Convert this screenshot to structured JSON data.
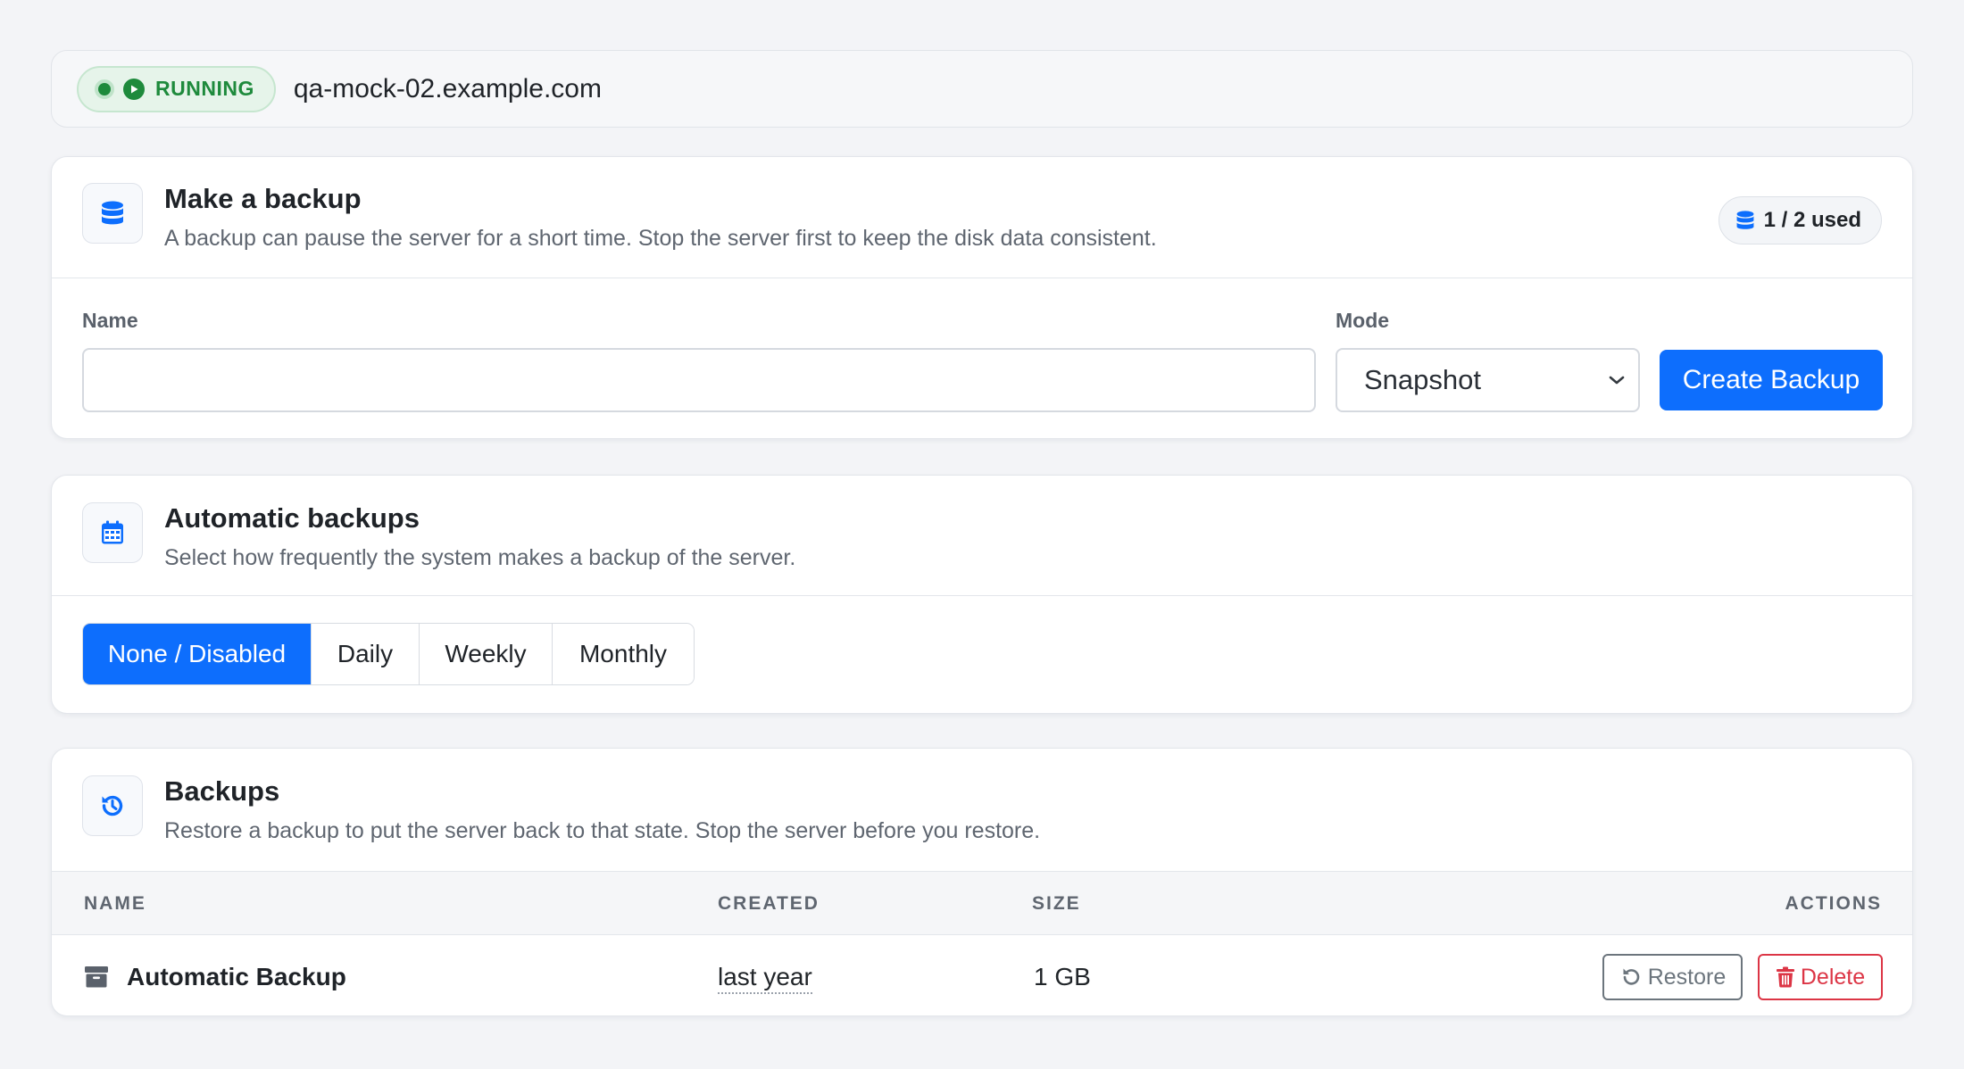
{
  "status": {
    "state_label": "RUNNING",
    "hostname": "qa-mock-02.example.com",
    "state_color": "#1e8a3c"
  },
  "make_backup": {
    "icon": "database-icon",
    "title": "Make a backup",
    "subtitle": "A backup can pause the server for a short time. Stop the server first to keep the disk data consistent.",
    "usage": "1 / 2 used",
    "name_label": "Name",
    "name_value": "",
    "name_placeholder": "",
    "mode_label": "Mode",
    "mode_value": "Snapshot",
    "create_label": "Create Backup"
  },
  "automatic": {
    "icon": "calendar-icon",
    "title": "Automatic backups",
    "subtitle": "Select how frequently the system makes a backup of the server.",
    "options": [
      "None / Disabled",
      "Daily",
      "Weekly",
      "Monthly"
    ],
    "selected": "None / Disabled"
  },
  "backups": {
    "icon": "history-icon",
    "title": "Backups",
    "subtitle": "Restore a backup to put the server back to that state. Stop the server before you restore.",
    "columns": {
      "name": "NAME",
      "created": "CREATED",
      "size": "SIZE",
      "actions": "ACTIONS"
    },
    "rows": [
      {
        "name": "Automatic Backup",
        "created": "last year",
        "size": "1 GB",
        "restore_label": "Restore",
        "delete_label": "Delete"
      }
    ]
  },
  "colors": {
    "accent": "#0d6efd",
    "danger": "#dc3545",
    "secondary": "#6c757d",
    "background": "#f3f4f7"
  }
}
